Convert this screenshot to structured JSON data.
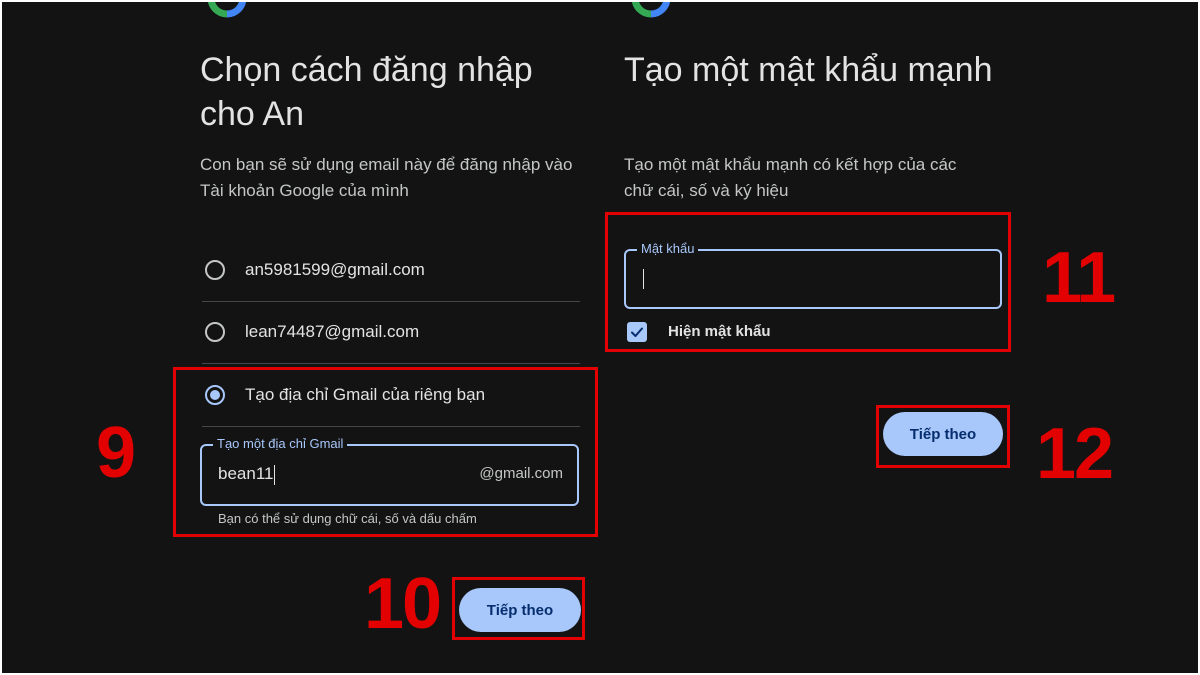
{
  "left": {
    "title": "Chọn cách đăng nhập cho An",
    "subtitle": "Con bạn sẽ sử dụng email này để đăng nhập vào Tài khoản Google của mình",
    "options": [
      {
        "label": "an5981599@gmail.com",
        "checked": false
      },
      {
        "label": "lean74487@gmail.com",
        "checked": false
      },
      {
        "label": "Tạo địa chỉ Gmail của riêng bạn",
        "checked": true
      }
    ],
    "gmail_field": {
      "label": "Tạo một địa chỉ Gmail",
      "value": "bean11",
      "suffix": "@gmail.com",
      "helper": "Bạn có thể sử dụng chữ cái, số và dấu chấm"
    },
    "next_label": "Tiếp theo"
  },
  "right": {
    "title": "Tạo một mật khẩu mạnh",
    "subtitle": "Tạo một mật khẩu mạnh có kết hợp của các chữ cái, số và ký hiệu",
    "password_field": {
      "label": "Mật khẩu",
      "value": ""
    },
    "show_password_label": "Hiện mật khẩu",
    "show_password_checked": true,
    "next_label": "Tiếp theo"
  },
  "step_numbers": [
    "9",
    "10",
    "11",
    "12"
  ],
  "colors": {
    "background": "#131314",
    "accent": "#a8c7fa",
    "annotation": "#e30000"
  }
}
